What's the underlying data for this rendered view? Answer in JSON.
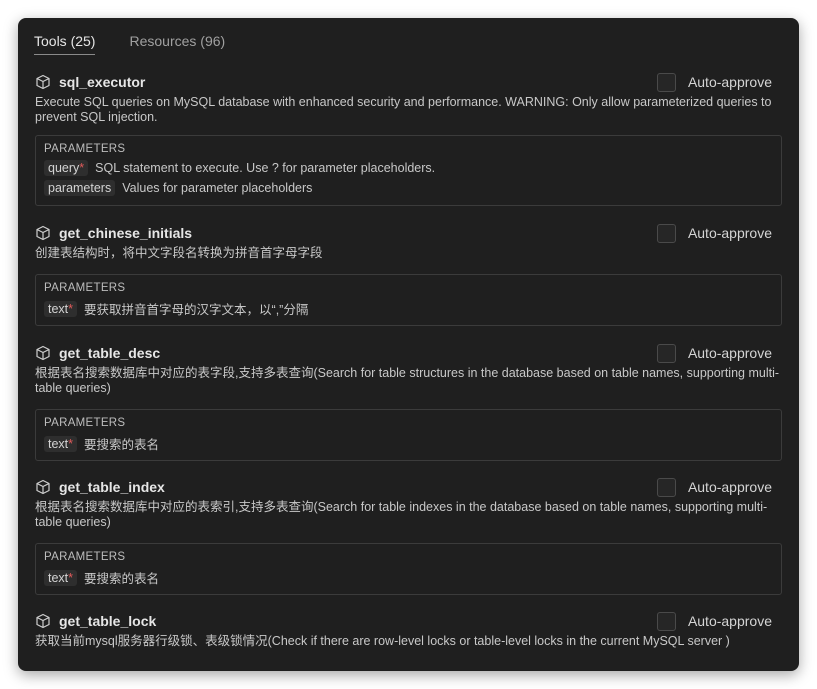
{
  "tabs": [
    {
      "label": "Tools (25)",
      "active": true
    },
    {
      "label": "Resources (96)",
      "active": false
    }
  ],
  "params_title": "PARAMETERS",
  "required_marker": "*",
  "auto_approve_label": "Auto-approve",
  "icon": "cube-icon",
  "tools": [
    {
      "name": "sql_executor",
      "description": "Execute SQL queries on MySQL database with enhanced security and performance. WARNING: Only allow parameterized queries to prevent SQL injection.",
      "params": [
        {
          "name": "query",
          "required": true,
          "desc": "SQL statement to execute. Use ? for parameter placeholders."
        },
        {
          "name": "parameters",
          "required": false,
          "desc": "Values for parameter placeholders"
        }
      ]
    },
    {
      "name": "get_chinese_initials",
      "description": "创建表结构时，将中文字段名转换为拼音首字母字段",
      "params": [
        {
          "name": "text",
          "required": true,
          "desc": "要获取拼音首字母的汉字文本，以“,”分隔"
        }
      ]
    },
    {
      "name": "get_table_desc",
      "description": "根据表名搜索数据库中对应的表字段,支持多表查询(Search for table structures in the database based on table names, supporting multi-table queries)",
      "params": [
        {
          "name": "text",
          "required": true,
          "desc": "要搜索的表名"
        }
      ]
    },
    {
      "name": "get_table_index",
      "description": "根据表名搜索数据库中对应的表索引,支持多表查询(Search for table indexes in the database based on table names, supporting multi-table queries)",
      "params": [
        {
          "name": "text",
          "required": true,
          "desc": "要搜索的表名"
        }
      ]
    },
    {
      "name": "get_table_lock",
      "description": "获取当前mysql服务器行级锁、表级锁情况(Check if there are row-level locks or table-level locks in the current MySQL server )",
      "params": []
    }
  ]
}
